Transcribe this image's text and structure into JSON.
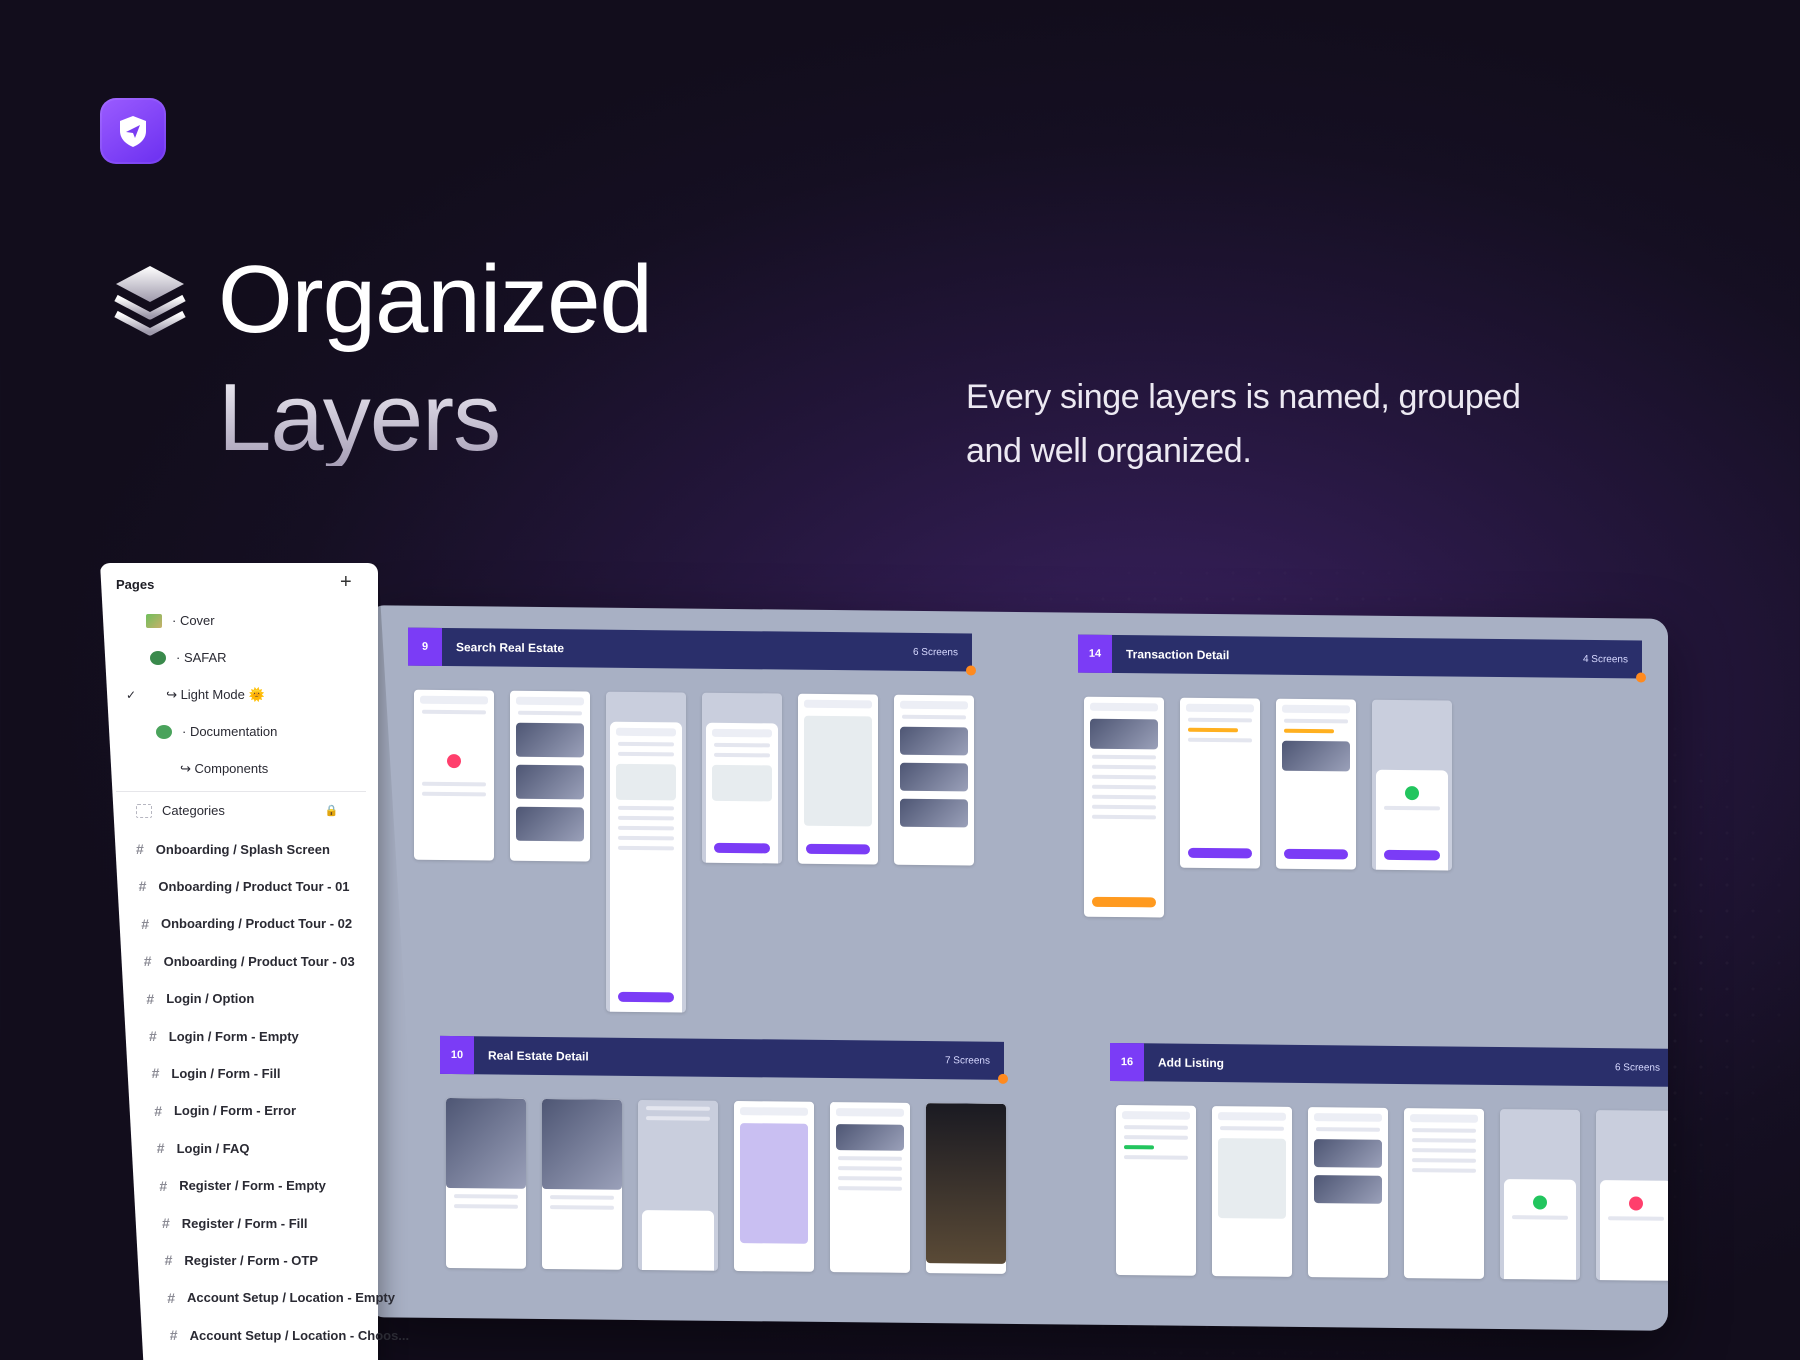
{
  "hero": {
    "title_line1": "Organized",
    "title_line2": "Layers",
    "tagline": "Every singe layers is named, grouped and well organized."
  },
  "sections": [
    {
      "num": "9",
      "name": "Search Real Estate",
      "count": "6 Screens"
    },
    {
      "num": "14",
      "name": "Transaction Detail",
      "count": "4 Screens"
    },
    {
      "num": "10",
      "name": "Real Estate Detail",
      "count": "7 Screens"
    },
    {
      "num": "16",
      "name": "Add Listing",
      "count": "6 Screens"
    }
  ],
  "pages_panel": {
    "title": "Pages",
    "add_label": "+",
    "pages": [
      {
        "label": "·  Cover"
      },
      {
        "label": "·  SAFAR"
      },
      {
        "label": "↪ Light Mode 🌞",
        "checked": true
      },
      {
        "label": "·  Documentation"
      },
      {
        "label": "↪ Components"
      }
    ],
    "categories_label": "Categories",
    "layers": [
      "Onboarding / Splash Screen",
      "Onboarding / Product Tour - 01",
      "Onboarding / Product Tour - 02",
      "Onboarding / Product Tour - 03",
      "Login / Option",
      "Login / Form - Empty",
      "Login / Form - Fill",
      "Login / Form - Error",
      "Login / FAQ",
      "Register / Form - Empty",
      "Register / Form - Fill",
      "Register / Form - OTP",
      "Account Setup / Location - Empty",
      "Account Setup / Location - Choos..."
    ]
  },
  "colors": {
    "accent": "#7b3cf6",
    "section_header": "#2a2f6b",
    "canvas": "#a8b0c4"
  }
}
